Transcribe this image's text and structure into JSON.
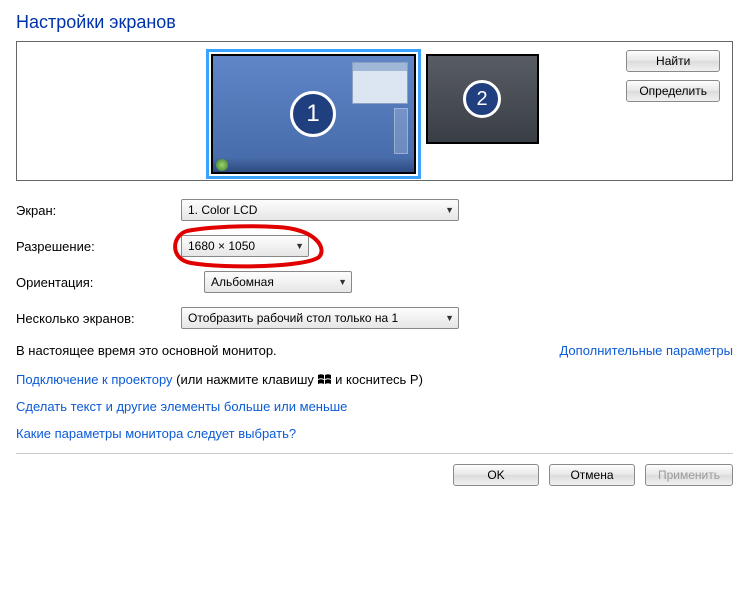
{
  "title": "Настройки экранов",
  "monitors": {
    "side_buttons": {
      "find": "Найти",
      "identify": "Определить"
    },
    "displays": [
      {
        "number": "1",
        "selected": true
      },
      {
        "number": "2",
        "selected": false
      }
    ]
  },
  "form": {
    "display_label": "Экран:",
    "display_value": "1. Color LCD",
    "resolution_label": "Разрешение:",
    "resolution_value": "1680 × 1050",
    "orientation_label": "Ориентация:",
    "orientation_value": "Альбомная",
    "multi_label": "Несколько экранов:",
    "multi_value": "Отобразить рабочий стол только на 1"
  },
  "info": {
    "primary_text": "В настоящее время это основной монитор.",
    "advanced_link": "Дополнительные параметры"
  },
  "links": {
    "projector_link": "Подключение к проектору",
    "projector_suffix_pre": " (или нажмите клавишу ",
    "projector_suffix_post": " и коснитесь P)",
    "text_size": "Сделать текст и другие элементы больше или меньше",
    "which_settings": "Какие параметры монитора следует выбрать?"
  },
  "footer": {
    "ok": "OK",
    "cancel": "Отмена",
    "apply": "Применить"
  }
}
